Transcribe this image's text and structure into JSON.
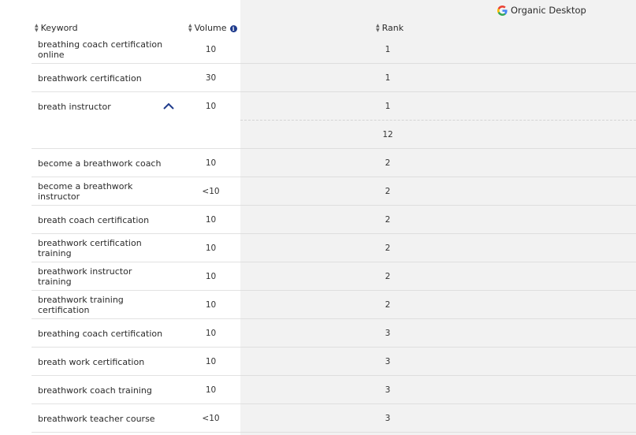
{
  "header": {
    "engine_label": "Organic Desktop",
    "keyword_col": "Keyword",
    "volume_col": "Volume",
    "rank_col": "Rank",
    "info_glyph": "i"
  },
  "colors": {
    "right_panel_bg": "#f2f2f2",
    "info_icon": "#1f3b8c",
    "chevron": "#1f3b8c"
  },
  "rows": [
    {
      "keyword": "breathing coach certification online",
      "volume": "10",
      "rank": "1"
    },
    {
      "keyword": "breathwork certification",
      "volume": "30",
      "rank": "1"
    },
    {
      "keyword": "breath instructor",
      "volume": "10",
      "rank": "1",
      "expanded": true
    },
    {
      "keyword": "",
      "volume": "",
      "rank": "12"
    },
    {
      "keyword": "become a breathwork coach",
      "volume": "10",
      "rank": "2"
    },
    {
      "keyword": "become a breathwork instructor",
      "volume": "<10",
      "rank": "2"
    },
    {
      "keyword": "breath coach certification",
      "volume": "10",
      "rank": "2"
    },
    {
      "keyword": "breathwork certification training",
      "volume": "10",
      "rank": "2"
    },
    {
      "keyword": "breathwork instructor training",
      "volume": "10",
      "rank": "2"
    },
    {
      "keyword": "breathwork training certification",
      "volume": "10",
      "rank": "2"
    },
    {
      "keyword": "breathing coach certification",
      "volume": "10",
      "rank": "3"
    },
    {
      "keyword": "breath work certification",
      "volume": "10",
      "rank": "3"
    },
    {
      "keyword": "breathwork coach training",
      "volume": "10",
      "rank": "3"
    },
    {
      "keyword": "breathwork teacher course",
      "volume": "<10",
      "rank": "3"
    }
  ]
}
